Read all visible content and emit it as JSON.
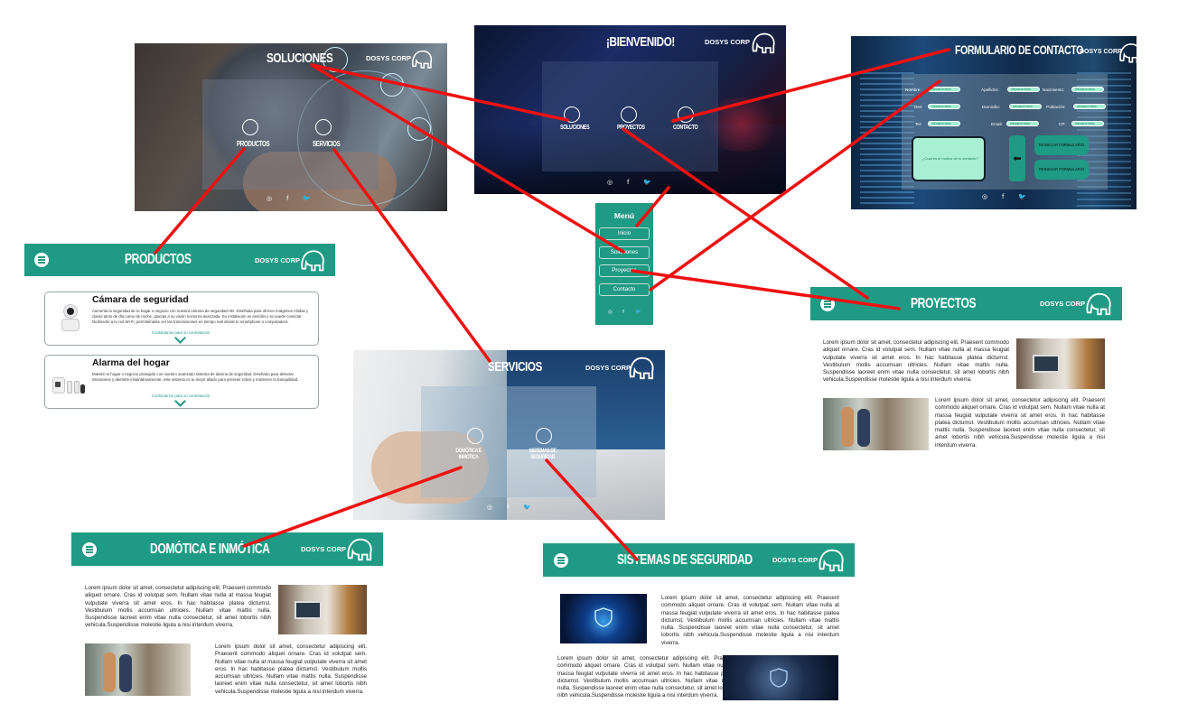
{
  "brand": {
    "name": "DOSYS CORP"
  },
  "social": {
    "instagram": "◎",
    "facebook": "f",
    "twitter": "🐦"
  },
  "soluciones": {
    "title": "SOLUCIONES",
    "items": [
      "PRODUCTOS",
      "SERVICIOS"
    ]
  },
  "bienvenido": {
    "title": "¡BIENVENIDO!",
    "items": [
      "SOLUCIONES",
      "PROYECTOS",
      "CONTACTO"
    ]
  },
  "contacto": {
    "title": "FORMULARIO DE CONTACTO",
    "fields": [
      {
        "label": "Nombre:",
        "value": "Introducir texto"
      },
      {
        "label": "Apellidos:",
        "value": "Introducir texto"
      },
      {
        "label": "Nacimiento:",
        "value": "Introducir texto"
      },
      {
        "label": "DNI:",
        "value": "Introducir texto"
      },
      {
        "label": "Domicilio:",
        "value": "Introducir texto"
      },
      {
        "label": "Población:",
        "value": "Introducir texto"
      },
      {
        "label": "Tel:",
        "value": "Introducir texto"
      },
      {
        "label": "Email:",
        "value": "Introducir texto"
      },
      {
        "label": "CP:",
        "value": "Introducir texto"
      }
    ],
    "message_placeholder": "¿Cuál es el motivo de tu contacto?",
    "button1": "REINICIAR FORMULARIO",
    "button2": "REINICIAR FORMULARIO"
  },
  "menu": {
    "title": "Menú",
    "items": [
      "Inicio",
      "Soluciones",
      "Proyectos",
      "Contacto"
    ]
  },
  "productos": {
    "title": "PRODUCTOS",
    "cards": [
      {
        "title": "Cámara de seguridad",
        "desc": "Aumenta la seguridad de tu hogar o negocio con nuestra cámara de seguridad HD. Diseñada para ofrecer imágenes nítidas y claras tanto de día como de noche, gracias a su visión nocturna avanzada. Su instalación es sencilla y se puede conectar fácilmente a tu red Wi-Fi, permitiéndote ver las transmisiones en tiempo real desde tu smartphone o computadora.",
        "link": "Contáctanos para su contratación"
      },
      {
        "title": "Alarma del hogar",
        "desc": "Mantén tu hogar o negocio protegido con nuestro avanzado sistema de alarma de seguridad. Diseñado para detectar intrusiones y alertarte instantáneamente, este sistema es tu mejor aliado para prevenir robos y mantener la tranquilidad.",
        "link": "Contáctanos para su contratación"
      }
    ]
  },
  "servicios": {
    "title": "SERVICIOS",
    "items": [
      "DOMÓTICA E INMÓTICA",
      "SISTEMAS DE SEGURIDAD"
    ]
  },
  "proyectos": {
    "title": "PROYECTOS"
  },
  "domotica": {
    "title": "DOMÓTICA E INMÓTICA"
  },
  "seguridad": {
    "title": "SISTEMAS DE SEGURIDAD"
  },
  "lorem": {
    "a": "Lorem ipsum dolor sit amet, consectetur adipiscing elit. Praesent commodo aliquet ornare. Cras id volutpat sem. Nullam vitae nulla at massa feugiat vulputate viverra sit amet eros. In hac habitasse platea dictumst. Vestibulum mollis accumsan ultricies. Nullam vitae mattis nulla. Suspendisse laoreet enim vitae nulla consectetur, sit amet lobortis nibh vehicula.Suspendisse molestie ligula a nisi interdum viverra."
  }
}
